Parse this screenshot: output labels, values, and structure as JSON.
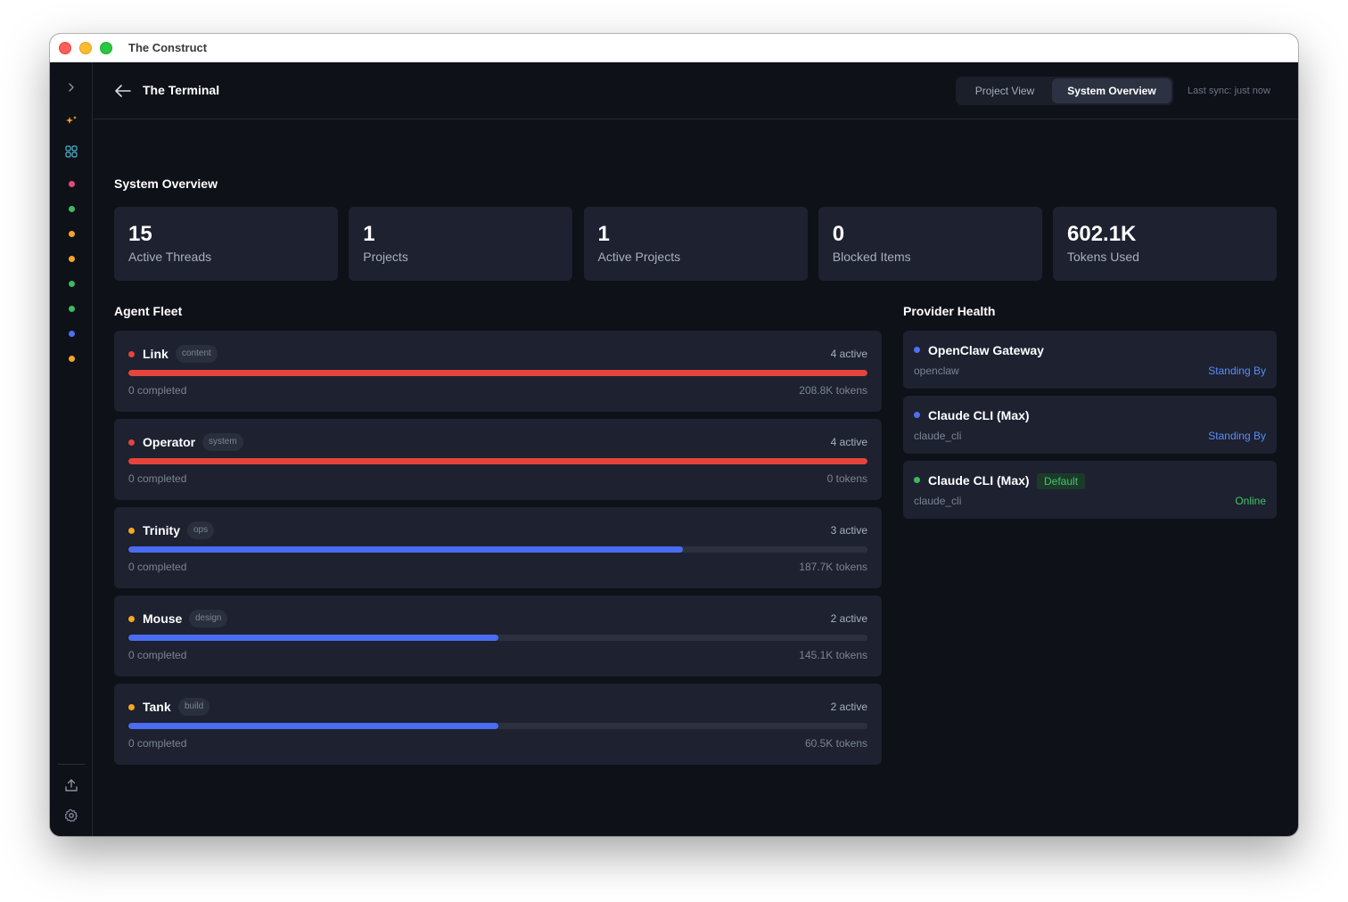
{
  "window": {
    "title": "The Construct"
  },
  "colors": {
    "red": "#e5443c",
    "orange": "#f5a623",
    "green": "#3fb95f",
    "blue": "#4f6ff0",
    "pink": "#e5497c",
    "teal": "#4ab5c9",
    "progress_blue": "#4a6cf0",
    "progress_red": "#e5443c",
    "standing_by": "#5a8cf5",
    "online": "#43c46a"
  },
  "sidebar": {
    "icons": [
      "chevron-right-icon",
      "sparkle-icon",
      "grid-icon",
      "upload-icon",
      "gear-icon"
    ],
    "status_dots": [
      "pink",
      "green",
      "orange",
      "orange",
      "green",
      "green",
      "blue",
      "orange"
    ]
  },
  "header": {
    "title": "The Terminal",
    "tabs": [
      {
        "label": "Project View"
      },
      {
        "label": "System Overview",
        "active": true
      }
    ],
    "last_sync": "Last sync: just now"
  },
  "overview": {
    "title": "System Overview",
    "stats": [
      {
        "value": "15",
        "label": "Active Threads"
      },
      {
        "value": "1",
        "label": "Projects"
      },
      {
        "value": "1",
        "label": "Active Projects"
      },
      {
        "value": "0",
        "label": "Blocked Items"
      },
      {
        "value": "602.1K",
        "label": "Tokens Used"
      }
    ]
  },
  "fleet": {
    "title": "Agent Fleet",
    "agents": [
      {
        "name": "Link",
        "tag": "content",
        "active": "4 active",
        "completed": "0 completed",
        "tokens": "208.8K tokens",
        "status_color": "red",
        "progress": 1.0,
        "bar_color": "progress_red"
      },
      {
        "name": "Operator",
        "tag": "system",
        "active": "4 active",
        "completed": "0 completed",
        "tokens": "0 tokens",
        "status_color": "red",
        "progress": 1.0,
        "bar_color": "progress_red"
      },
      {
        "name": "Trinity",
        "tag": "ops",
        "active": "3 active",
        "completed": "0 completed",
        "tokens": "187.7K tokens",
        "status_color": "orange",
        "progress": 0.75,
        "bar_color": "progress_blue"
      },
      {
        "name": "Mouse",
        "tag": "design",
        "active": "2 active",
        "completed": "0 completed",
        "tokens": "145.1K tokens",
        "status_color": "orange",
        "progress": 0.5,
        "bar_color": "progress_blue"
      },
      {
        "name": "Tank",
        "tag": "build",
        "active": "2 active",
        "completed": "0 completed",
        "tokens": "60.5K tokens",
        "status_color": "orange",
        "progress": 0.5,
        "bar_color": "progress_blue"
      }
    ]
  },
  "providers": {
    "title": "Provider Health",
    "items": [
      {
        "name": "OpenClaw Gateway",
        "id": "openclaw",
        "status": "Standing By",
        "dot": "blue",
        "status_color": "standing_by"
      },
      {
        "name": "Claude CLI (Max)",
        "id": "claude_cli",
        "status": "Standing By",
        "dot": "blue",
        "status_color": "standing_by"
      },
      {
        "name": "Claude CLI (Max)",
        "badge": "Default",
        "id": "claude_cli",
        "status": "Online",
        "dot": "green",
        "status_color": "online"
      }
    ]
  }
}
